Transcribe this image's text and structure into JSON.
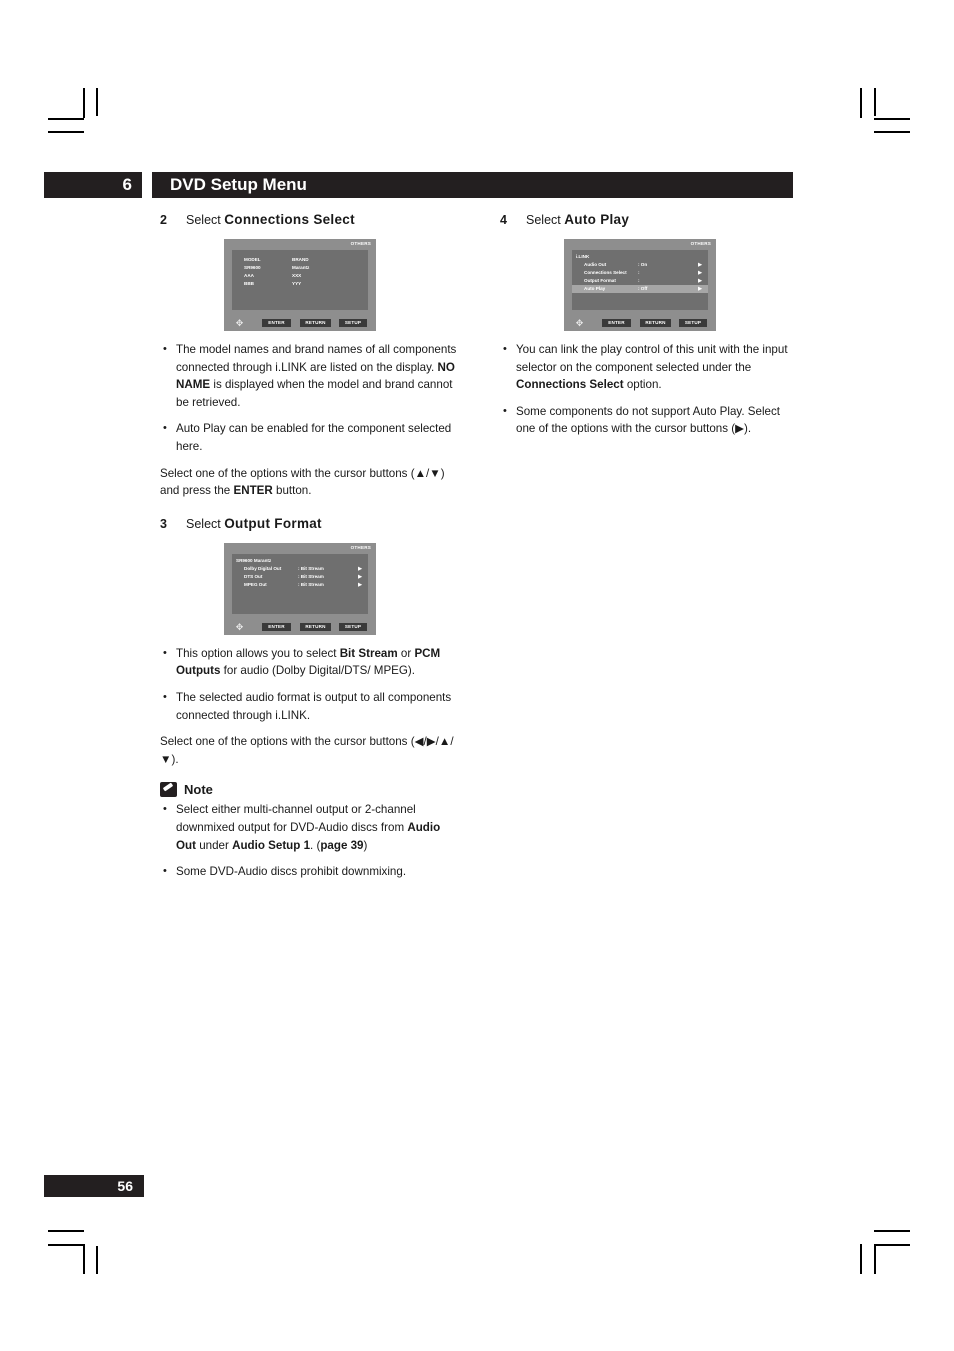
{
  "page": {
    "chapter_number": "6",
    "header_title": "DVD Setup Menu",
    "page_number": "56"
  },
  "left_column": {
    "step2": {
      "number": "2",
      "prefix": "Select ",
      "bold": "Connections Select"
    },
    "osd_connections": {
      "corner_label": "OTHERS",
      "col_headers": {
        "left": "MODEL",
        "right": "BRAND"
      },
      "rows": [
        {
          "model": "SR9600",
          "brand": "Marantz"
        },
        {
          "model": "AAA",
          "brand": "XXX"
        },
        {
          "model": "BBB",
          "brand": "YYY"
        }
      ],
      "keys": {
        "enter": "ENTER",
        "return": "RETURN",
        "setup": "SETUP"
      }
    },
    "bullets_step2": [
      "The model names and brand names of all components connected through i.LINK are listed on the display. NO NAME is displayed when the model and brand cannot be retrieved.",
      "Auto Play can be enabled for the component selected here."
    ],
    "para_step2": "Select one of the options with the cursor buttons (▲/▼) and press the ENTER button.",
    "step3": {
      "number": "3",
      "prefix": "Select ",
      "bold": "Output Format"
    },
    "osd_output_format": {
      "corner_label": "OTHERS",
      "title": "SR9600   Marantz",
      "items": [
        {
          "label": "Dolby Digital Out",
          "value": ": Bit Stream",
          "arrow": "▶"
        },
        {
          "label": "DTS Out",
          "value": ": Bit Stream",
          "arrow": "▶"
        },
        {
          "label": "MPEG Out",
          "value": ": Bit Stream",
          "arrow": "▶"
        }
      ],
      "keys": {
        "enter": "ENTER",
        "return": "RETURN",
        "setup": "SETUP"
      }
    },
    "bullets_step3": [
      "This option allows you to select Bit Stream or PCM Outputs for audio (Dolby Digital/DTS/MPEG).",
      "The selected audio format is output to all components connected through i.LINK."
    ],
    "para_step3": "Select one of the options with the cursor buttons (◀/▶/▲/▼).",
    "note": {
      "title": "Note",
      "bullets": [
        "Select either multi-channel output or 2-channel downmixed output for DVD-Audio discs from Audio Out under Audio Setup 1. (page 39)",
        "Some DVD-Audio discs prohibit downmixing."
      ]
    }
  },
  "right_column": {
    "step4": {
      "number": "4",
      "prefix": "Select ",
      "bold": "Auto Play"
    },
    "osd_auto_play": {
      "corner_label": "OTHERS",
      "title": "i.LINK",
      "items": [
        {
          "label": "Audio Out",
          "value": ": On",
          "arrow": "▶",
          "selected": false
        },
        {
          "label": "Connections Select",
          "value": ":",
          "arrow": "▶",
          "selected": false
        },
        {
          "label": "Output Format",
          "value": ":",
          "arrow": "▶",
          "selected": false
        },
        {
          "label": "Auto Play",
          "value": ": Off",
          "arrow": "▶",
          "selected": true
        }
      ],
      "keys": {
        "enter": "ENTER",
        "return": "RETURN",
        "setup": "SETUP"
      }
    },
    "bullets_step4": [
      "You can link the play control of this unit with the input selector on the component selected under the Connections Select option.",
      "Some components do not support Auto Play. Select one of the options with the cursor buttons (▶)."
    ]
  },
  "colors": {
    "ink": "#231f20",
    "osd_frame": "#8e8e8e",
    "osd_screen": "#6f6f6f",
    "osd_highlight": "#a6a6a6",
    "osd_key": "#3a3a3a"
  }
}
